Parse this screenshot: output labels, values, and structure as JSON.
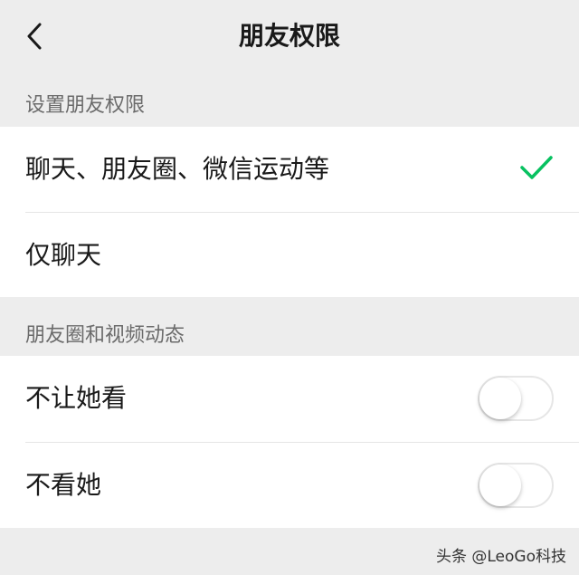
{
  "nav": {
    "title": "朋友权限",
    "back_icon": "chevron-left-icon"
  },
  "permission_section": {
    "header": "设置朋友权限",
    "options": [
      {
        "label": "聊天、朋友圈、微信运动等",
        "selected": true
      },
      {
        "label": "仅聊天",
        "selected": false
      }
    ],
    "check_icon": "checkmark-icon",
    "check_color": "#07c160"
  },
  "moments_section": {
    "header": "朋友圈和视频动态",
    "toggles": [
      {
        "label": "不让她看",
        "on": false
      },
      {
        "label": "不看她",
        "on": false
      }
    ]
  },
  "watermark": {
    "text": "头条 @LeoGo科技"
  }
}
